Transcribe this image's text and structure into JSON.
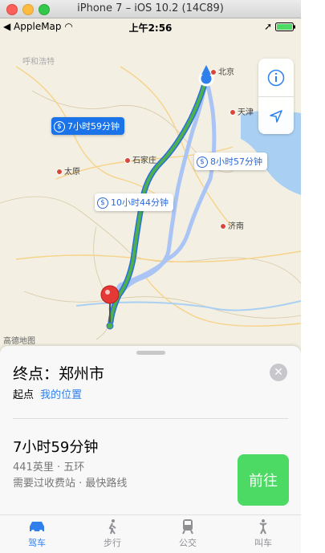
{
  "window": {
    "title": "iPhone 7 – iOS 10.2 (14C89)"
  },
  "status": {
    "carrier": "AppleMap",
    "time": "上午2:56"
  },
  "map": {
    "cities": {
      "shijiazhuang": "石家庄",
      "taiyuan": "太原",
      "beijing": "北京",
      "tianjin": "天津",
      "jinan": "济南",
      "faded": "呼和浩特"
    },
    "routes": {
      "selected": "7小时59分钟",
      "alt1": "10小时44分钟",
      "alt2": "8小时57分钟"
    },
    "attribution": "高德地图",
    "colors": {
      "selected_route": "#4caf50",
      "selected_outline": "#2a6fdc",
      "alt_route": "#a9c4f5",
      "origin": "#2f80ed",
      "pin": "#e53935"
    }
  },
  "sheet": {
    "destination": "终点：郑州市",
    "from_label": "起点",
    "from_value": "我的位置",
    "duration": "7小时59分钟",
    "distance": "441英里 · 五环",
    "note": "需要过收费站 · 最快路线",
    "go_label": "前往"
  },
  "tabs": [
    {
      "label": "驾车",
      "icon": "car-icon"
    },
    {
      "label": "步行",
      "icon": "walk-icon"
    },
    {
      "label": "公交",
      "icon": "transit-icon"
    },
    {
      "label": "叫车",
      "icon": "rideshare-icon"
    }
  ]
}
